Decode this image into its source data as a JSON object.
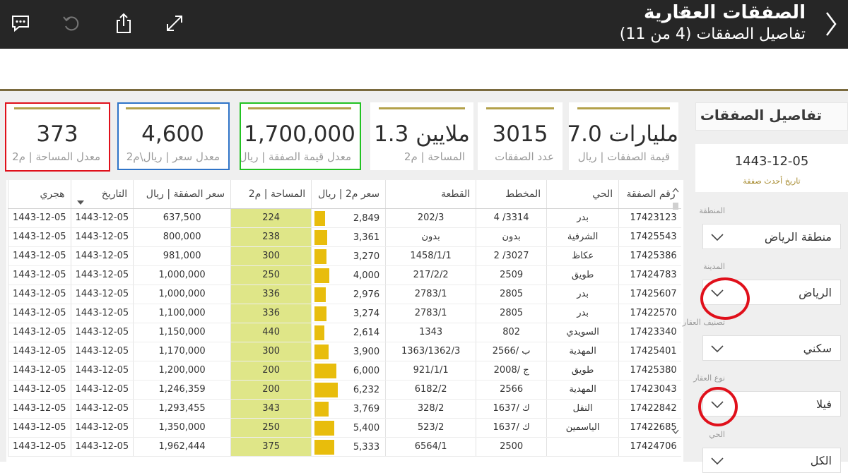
{
  "header": {
    "title": "الصفقات العقارية",
    "subtitle": "تفاصيل الصفقات (4 من 11)"
  },
  "toolbar": {
    "comment_icon": "comment-icon",
    "undo_icon": "undo-icon",
    "share_icon": "share-icon",
    "expand_icon": "expand-icon"
  },
  "kpis": [
    {
      "value": "مليارات 7.0",
      "label": "قيمة الصفقات | ريال"
    },
    {
      "value": "3015",
      "label": "عدد الصفقات"
    },
    {
      "value": "ملايين 1.3",
      "label": "المساحة | م2"
    },
    {
      "value": "1,700,000",
      "label": "معدل قيمة الصفقة | ريال"
    },
    {
      "value": "4,600",
      "label": "معدل سعر | ريال\\م2"
    },
    {
      "value": "373",
      "label": "معدل المساحة | م2"
    }
  ],
  "highlight_colors": {
    "red": "#e0101b",
    "blue": "#2f74c8",
    "green": "#22c222"
  },
  "table": {
    "columns": [
      "رقم الصفقة",
      "الحي",
      "المخطط",
      "القطعة",
      "سعر م2 | ريال",
      "المساحة | م2",
      "سعر الصفقة | ريال",
      "التاريخ",
      "هجري"
    ],
    "rows": [
      [
        "17423123",
        "بدر",
        "3314/ 4",
        "202/3",
        "2,849",
        "224",
        "637,500",
        "1443-12-05",
        "1443-12-05"
      ],
      [
        "17425543",
        "الشرفية",
        "بدون",
        "بدون",
        "3,361",
        "238",
        "800,000",
        "1443-12-05",
        "1443-12-05"
      ],
      [
        "17425386",
        "عكاظ",
        "3027/ 2",
        "1458/1/1",
        "3,270",
        "300",
        "981,000",
        "1443-12-05",
        "1443-12-05"
      ],
      [
        "17424783",
        "طويق",
        "2509",
        "217/2/2",
        "4,000",
        "250",
        "1,000,000",
        "1443-12-05",
        "1443-12-05"
      ],
      [
        "17425607",
        "بدر",
        "2805",
        "2783/1",
        "2,976",
        "336",
        "1,000,000",
        "1443-12-05",
        "1443-12-05"
      ],
      [
        "17422570",
        "بدر",
        "2805",
        "2783/1",
        "3,274",
        "336",
        "1,100,000",
        "1443-12-05",
        "1443-12-05"
      ],
      [
        "17423340",
        "السويدي",
        "802",
        "1343",
        "2,614",
        "440",
        "1,150,000",
        "1443-12-05",
        "1443-12-05"
      ],
      [
        "17425401",
        "المهدية",
        "ب /2566",
        "1363/1362/3",
        "3,900",
        "300",
        "1,170,000",
        "1443-12-05",
        "1443-12-05"
      ],
      [
        "17425380",
        "طويق",
        "ج /2008",
        "921/1/1",
        "6,000",
        "200",
        "1,200,000",
        "1443-12-05",
        "1443-12-05"
      ],
      [
        "17423043",
        "المهدية",
        "2566",
        "6182/2",
        "6,232",
        "200",
        "1,246,359",
        "1443-12-05",
        "1443-12-05"
      ],
      [
        "17422842",
        "النفل",
        "ك /1637",
        "328/2",
        "3,769",
        "343",
        "1,293,455",
        "1443-12-05",
        "1443-12-05"
      ],
      [
        "17422685",
        "الياسمين",
        "ك /1637",
        "523/2",
        "5,400",
        "250",
        "1,350,000",
        "1443-12-05",
        "1443-12-05"
      ],
      [
        "17424706",
        "",
        "2500",
        "6564/1",
        "5,333",
        "375",
        "1,962,444",
        "1443-12-05",
        "1443-12-05"
      ]
    ],
    "price_bar_max": 6500,
    "bar_color": "#e8bd0c",
    "area_cell_color": "#dfe688"
  },
  "sidebar": {
    "title": "تفاصيل الصفقات",
    "latest_date": "1443-12-05",
    "latest_date_label": "تاريخ أحدث صفقة",
    "filters": [
      {
        "label": "المنطقة",
        "value": "منطقة الرياض"
      },
      {
        "label": "المدينة",
        "value": "الرياض"
      },
      {
        "label": "تصنيف العقار",
        "value": "سكني"
      },
      {
        "label": "نوع العقار",
        "value": "فيلا"
      },
      {
        "label": "الحي",
        "value": "الكل"
      }
    ]
  }
}
